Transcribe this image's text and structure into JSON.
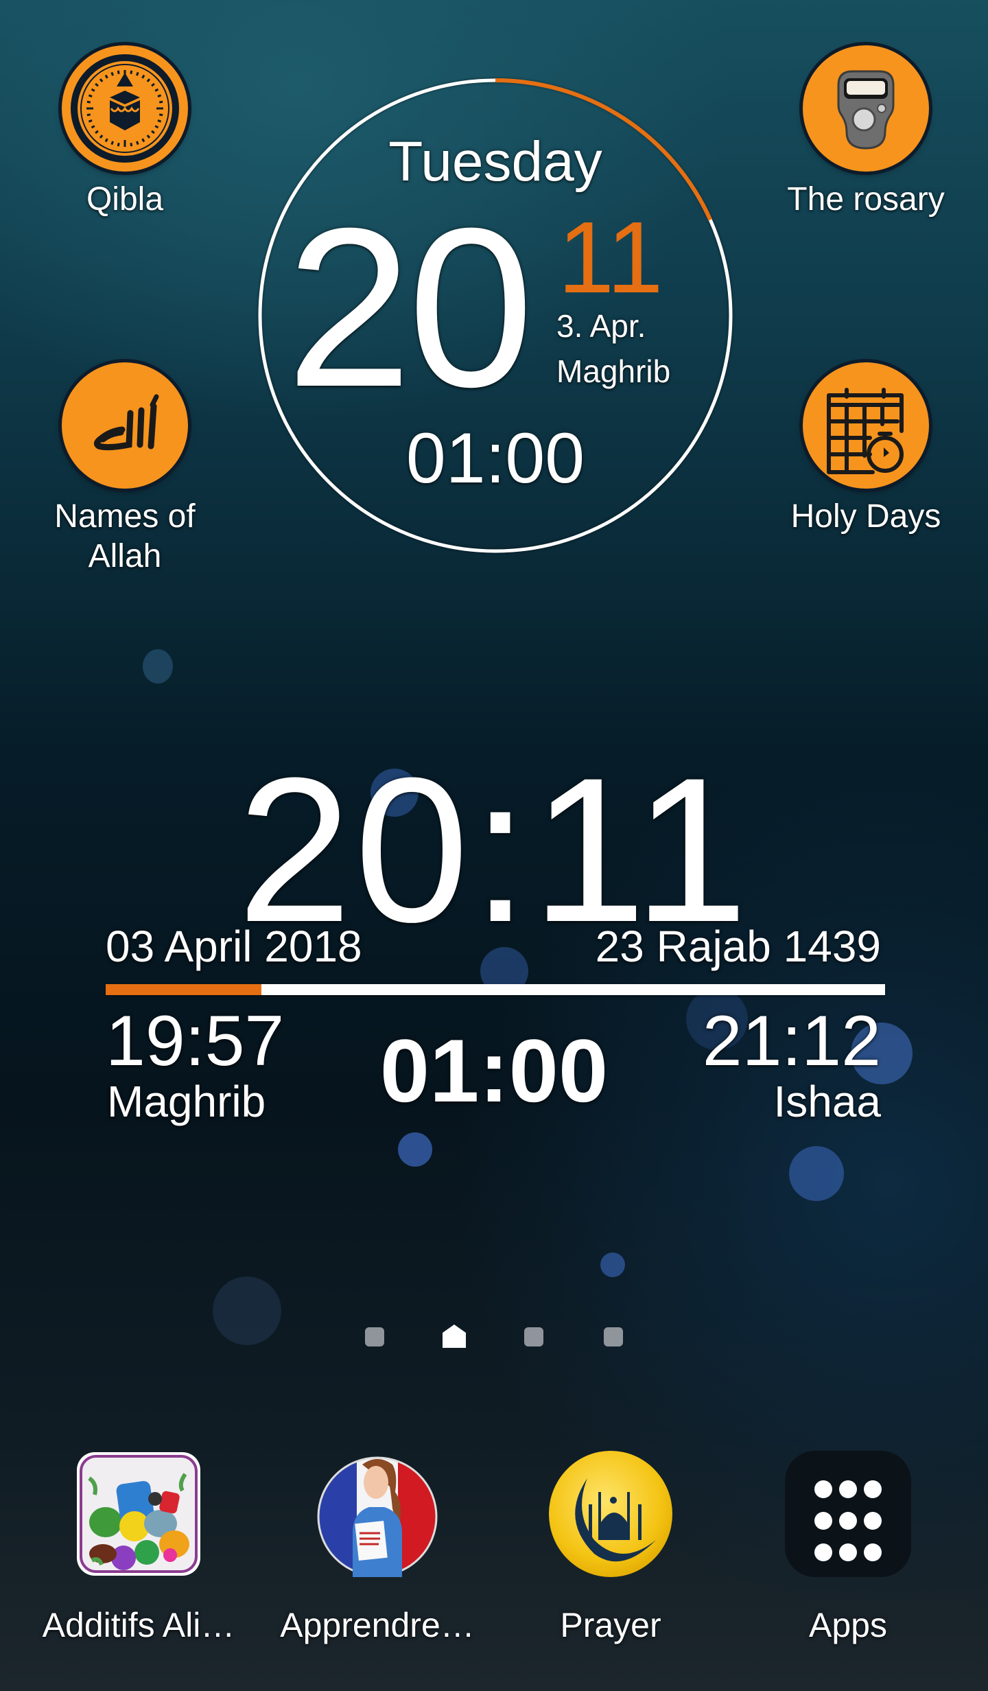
{
  "colors": {
    "accent_orange": "#e56f12",
    "icon_orange": "#f7941d",
    "icon_outline": "#0d1b2a",
    "text": "#ffffff"
  },
  "top_apps": [
    {
      "label": "Qibla",
      "icon": "kaaba-compass-icon"
    },
    {
      "label": "The rosary",
      "icon": "tally-counter-icon"
    },
    {
      "label": "Names of\nAllah",
      "label_line1": "Names of",
      "label_line2": "Allah",
      "icon": "allah-calligraphy-icon"
    },
    {
      "label": "Holy Days",
      "icon": "calendar-timer-icon"
    }
  ],
  "ring_clock": {
    "day": "Tuesday",
    "hour": "20",
    "minute": "11",
    "date": "3. Apr.",
    "prayer": "Maghrib",
    "countdown": "01:00",
    "minute_progress": 0.1833
  },
  "main_clock": {
    "time": "20:11",
    "gregorian_date": "03 April 2018",
    "hijri_date": "23 Rajab 1439",
    "progress_fraction": 0.2,
    "previous_prayer": {
      "time": "19:57",
      "name": "Maghrib"
    },
    "countdown": "01:00",
    "next_prayer": {
      "time": "21:12",
      "name": "Ishaa"
    }
  },
  "page_indicator": {
    "pages": 4,
    "current_index": 1,
    "home_index": 1
  },
  "dock": [
    {
      "label": "Additifs Ali…",
      "icon": "food-additives-app-icon"
    },
    {
      "label": "Apprendre…",
      "icon": "learn-french-app-icon"
    },
    {
      "label": "Prayer",
      "icon": "prayer-mosque-crescent-icon"
    },
    {
      "label": "Apps",
      "icon": "apps-grid-icon"
    }
  ]
}
